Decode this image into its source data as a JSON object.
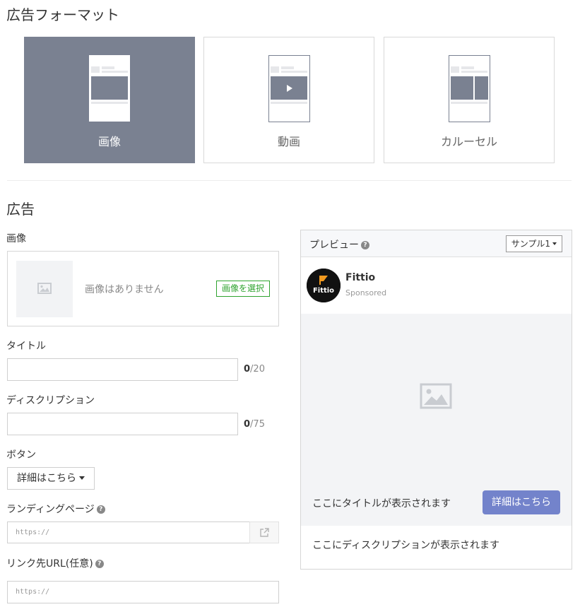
{
  "format_section": {
    "title": "広告フォーマット",
    "cards": [
      {
        "label": "画像",
        "selected": true
      },
      {
        "label": "動画",
        "selected": false
      },
      {
        "label": "カルーセル",
        "selected": false
      }
    ]
  },
  "ad_section": {
    "title": "広告",
    "image": {
      "label": "画像",
      "empty_text": "画像はありません",
      "select_label": "画像を選択",
      "placeholder_icon": "image-icon"
    },
    "title_field": {
      "label": "タイトル",
      "value": "",
      "count": "0",
      "max": "/20"
    },
    "description_field": {
      "label": "ディスクリプション",
      "value": "",
      "count": "0",
      "max": "/75"
    },
    "button_field": {
      "label": "ボタン",
      "selected": "詳細はこちら"
    },
    "landing_page": {
      "label": "ランディングページ",
      "placeholder": "https://",
      "help_icon": "question-circle-icon",
      "addon_icon": "external-link-icon"
    },
    "link_url": {
      "label": "リンク先URL(任意)",
      "placeholder": "https://",
      "help_icon": "question-circle-icon"
    }
  },
  "preview": {
    "title": "プレビュー",
    "help_icon": "question-circle-icon",
    "sample_selected": "サンプル1",
    "brand_name": "Fittio",
    "sponsored": "Sponsored",
    "avatar_text": "Fittio",
    "ad_title": "ここにタイトルが表示されます",
    "cta_label": "詳細はこちら",
    "ad_description": "ここにディスクリプションが表示されます"
  },
  "colors": {
    "selected_card": "#7a8191",
    "select_button": "#2fa32f",
    "cta_button": "#7383cb",
    "avatar_bg": "#111111",
    "logo_accent": "#f29a1f"
  }
}
